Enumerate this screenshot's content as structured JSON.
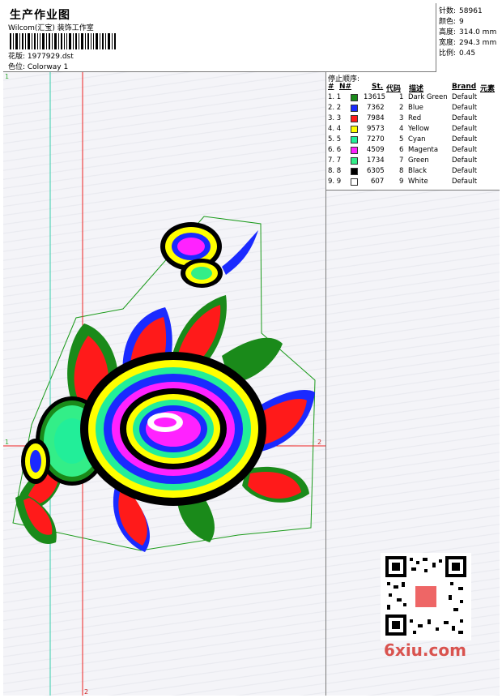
{
  "header": {
    "title": "生产作业图",
    "subtitle": "Wilcom(汇宝) 装饰工作室",
    "design_label": "花版: 1977929.dst",
    "colorway_label": "色位: Colorway 1"
  },
  "stats": [
    {
      "label": "针数:",
      "value": "58961"
    },
    {
      "label": "颜色:",
      "value": "9"
    },
    {
      "label": "高度:",
      "value": "314.0 mm"
    },
    {
      "label": "宽度:",
      "value": "294.3 mm"
    },
    {
      "label": "比例:",
      "value": "0.45"
    }
  ],
  "thread_table": {
    "title": "停止顺序:",
    "headers": {
      "num": "#",
      "n": "N#",
      "st": "St.",
      "code": "代码",
      "desc": "描述",
      "brand": "Brand",
      "element": "元素"
    },
    "rows": [
      {
        "num": "1. 1",
        "st": "13615",
        "code": "1",
        "desc": "Dark Green",
        "brand": "Default",
        "color": "#1a8a1a"
      },
      {
        "num": "2. 2",
        "st": "7362",
        "code": "2",
        "desc": "Blue",
        "brand": "Default",
        "color": "#1a2aff"
      },
      {
        "num": "3. 3",
        "st": "7984",
        "code": "3",
        "desc": "Red",
        "brand": "Default",
        "color": "#ff1a1a"
      },
      {
        "num": "4. 4",
        "st": "9573",
        "code": "4",
        "desc": "Yellow",
        "brand": "Default",
        "color": "#ffff00"
      },
      {
        "num": "5. 5",
        "st": "7270",
        "code": "5",
        "desc": "Cyan",
        "brand": "Default",
        "color": "#22ee99"
      },
      {
        "num": "6. 6",
        "st": "4509",
        "code": "6",
        "desc": "Magenta",
        "brand": "Default",
        "color": "#ff22ff"
      },
      {
        "num": "7. 7",
        "st": "1734",
        "code": "7",
        "desc": "Green",
        "brand": "Default",
        "color": "#33ee88"
      },
      {
        "num": "8. 8",
        "st": "6305",
        "code": "8",
        "desc": "Black",
        "brand": "Default",
        "color": "#000000"
      },
      {
        "num": "9. 9",
        "st": "607",
        "code": "9",
        "desc": "White",
        "brand": "Default",
        "color": "#ffffff"
      }
    ]
  },
  "guides": {
    "v1": "1",
    "v2": "2",
    "h1": "1",
    "h2": "2"
  },
  "watermark": "6xiu.com"
}
